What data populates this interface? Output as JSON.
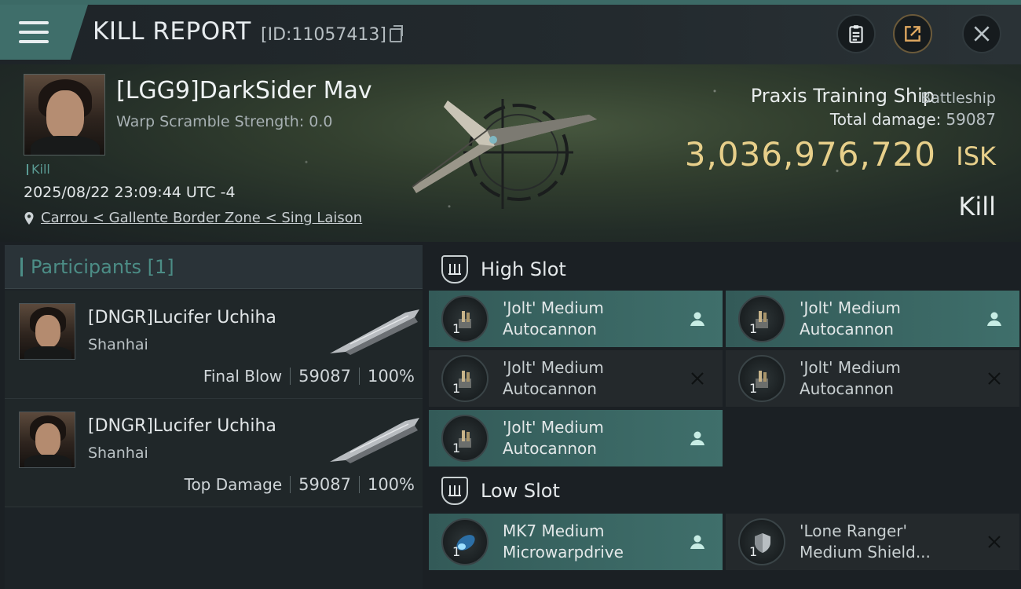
{
  "header": {
    "title": "KILL REPORT",
    "report_id": "[ID:11057413]"
  },
  "victim": {
    "name": "[LGG9]DarkSider Mav",
    "warp_scramble": "Warp Scramble Strength: 0.0",
    "kill_tag": "Kill",
    "timestamp": "2025/08/22 23:09:44 UTC -4",
    "location": "Carrou < Gallente Border Zone < Sing Laison"
  },
  "ship": {
    "name": "Praxis Training Ship",
    "class": "Battleship",
    "total_damage_label": "Total damage:",
    "total_damage_value": "59087",
    "isk_value": "3,036,976,720",
    "isk_unit": "ISK",
    "result": "Kill"
  },
  "participants": {
    "title": "Participants [1]",
    "rows": [
      {
        "name": "[DNGR]Lucifer Uchiha",
        "corp": "Shanhai",
        "role": "Final Blow",
        "damage": "59087",
        "percent": "100%"
      },
      {
        "name": "[DNGR]Lucifer Uchiha",
        "corp": "Shanhai",
        "role": "Top Damage",
        "damage": "59087",
        "percent": "100%"
      }
    ]
  },
  "fitting": {
    "high_slot_title": "High Slot",
    "low_slot_title": "Low Slot",
    "high_slot": [
      {
        "line1": "'Jolt' Medium",
        "line2": "Autocannon",
        "qty": "1",
        "status": "dropped",
        "icon": "autocannon-icon"
      },
      {
        "line1": "'Jolt' Medium",
        "line2": "Autocannon",
        "qty": "1",
        "status": "dropped",
        "icon": "autocannon-icon"
      },
      {
        "line1": "'Jolt' Medium",
        "line2": "Autocannon",
        "qty": "1",
        "status": "destroyed",
        "icon": "autocannon-icon"
      },
      {
        "line1": "'Jolt' Medium",
        "line2": "Autocannon",
        "qty": "1",
        "status": "destroyed",
        "icon": "autocannon-icon"
      },
      {
        "line1": "'Jolt' Medium",
        "line2": "Autocannon",
        "qty": "1",
        "status": "dropped",
        "icon": "autocannon-icon"
      }
    ],
    "low_slot": [
      {
        "line1": "MK7 Medium",
        "line2": "Microwarpdrive",
        "qty": "1",
        "status": "dropped",
        "icon": "microwarpdrive-icon"
      },
      {
        "line1": "'Lone Ranger'",
        "line2": "Medium Shield...",
        "qty": "1",
        "status": "destroyed",
        "icon": "shield-module-icon"
      }
    ]
  },
  "colors": {
    "accent_teal": "#3f6e6a",
    "isk_gold": "#e7cf8a",
    "loss_red": "#c1272d"
  }
}
